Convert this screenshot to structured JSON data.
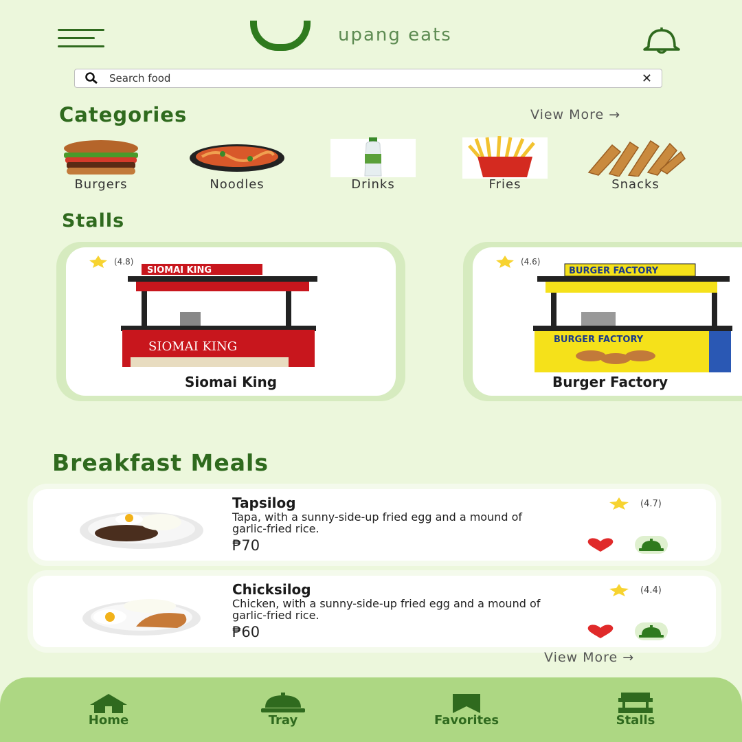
{
  "header": {
    "logo_letter": "U",
    "app_name": "upang eats"
  },
  "search": {
    "placeholder": "Search food",
    "value": ""
  },
  "categories": {
    "title": "Categories",
    "view_more": "View More →",
    "items": [
      {
        "label": "Burgers",
        "icon": "burger-icon"
      },
      {
        "label": "Noodles",
        "icon": "noodles-icon"
      },
      {
        "label": "Drinks",
        "icon": "drink-bottle-icon"
      },
      {
        "label": "Fries",
        "icon": "fries-icon"
      },
      {
        "label": "Snacks",
        "icon": "snacks-icon"
      }
    ]
  },
  "stalls": {
    "title": "Stalls",
    "items": [
      {
        "name": "Siomai King",
        "rating": "(4.8)",
        "sign_text": "SIOMAI KING",
        "cart_text": "SIOMAI KING",
        "color": "#c8161d"
      },
      {
        "name": "Burger Factory",
        "rating": "(4.6)",
        "sign_text": "BURGER FACTORY",
        "cart_text": "BURGER FACTORY",
        "color": "#f5e11a"
      }
    ]
  },
  "meals": {
    "title": "Breakfast Meals",
    "view_more": "View More →",
    "items": [
      {
        "name": "Tapsilog",
        "description": "Tapa, with a sunny-side-up fried egg and a mound of garlic-fried rice.",
        "price": "₱70",
        "rating": "(4.7)"
      },
      {
        "name": "Chicksilog",
        "description": "Chicken, with a sunny-side-up fried egg and a mound of garlic-fried rice.",
        "price": "₱60",
        "rating": "(4.4)"
      }
    ]
  },
  "nav": {
    "items": [
      {
        "label": "Home",
        "icon": "home-icon"
      },
      {
        "label": "Tray",
        "icon": "tray-icon"
      },
      {
        "label": "Favorites",
        "icon": "bookmark-icon"
      },
      {
        "label": "Stalls",
        "icon": "stall-icon"
      }
    ]
  },
  "colors": {
    "background": "#ecf7dc",
    "brand_green": "#2f6a1e",
    "nav_bar": "#add783",
    "heart": "#e02a2a",
    "star": "#f7d330"
  }
}
